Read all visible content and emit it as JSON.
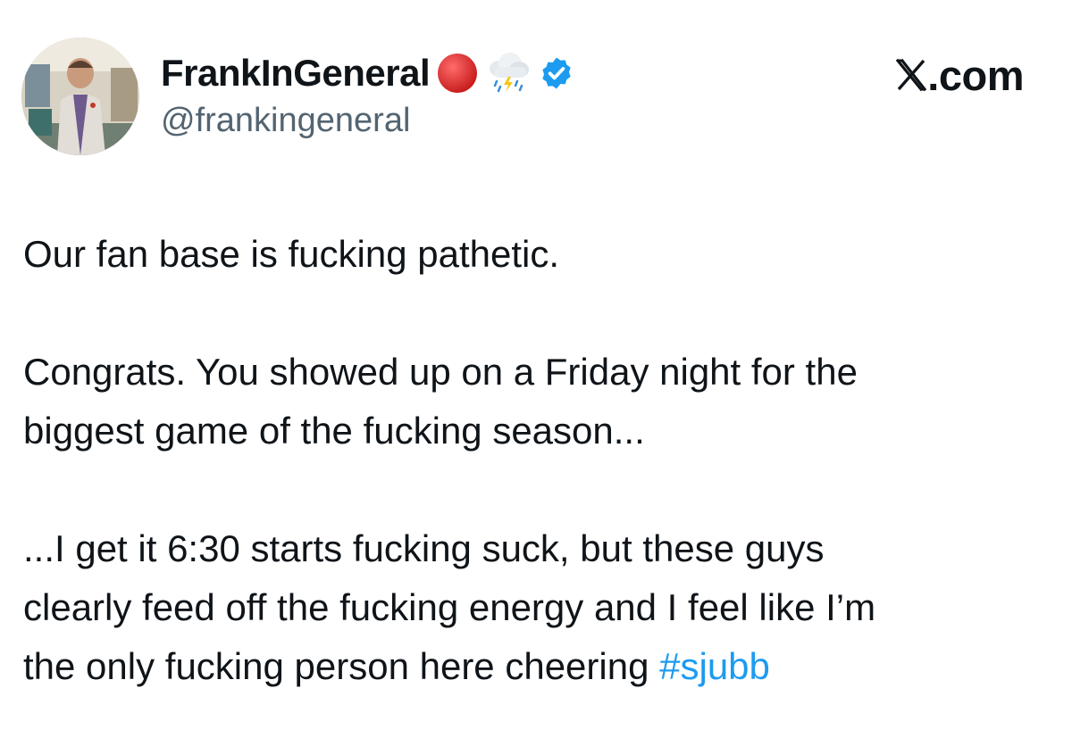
{
  "post": {
    "author": {
      "display_name": "FrankInGeneral",
      "handle": "@frankingeneral",
      "badges": [
        "red-circle-icon",
        "storm-cloud-icon",
        "verified-badge-icon"
      ]
    },
    "brand": {
      "logo": "x-logo-icon",
      "domain_suffix": ".com"
    },
    "body": {
      "paragraphs": [
        {
          "lines": [
            "Our fan base is fucking pathetic."
          ]
        },
        {
          "lines": [
            "Congrats. You showed up on a Friday night for the",
            "biggest game of the fucking season..."
          ]
        },
        {
          "lines": [
            "...I get it 6:30 starts fucking suck, but these guys",
            "clearly feed off the fucking energy and I feel like I’m",
            "the only fucking person here cheering "
          ],
          "hashtag": "#sjubb"
        }
      ]
    }
  },
  "colors": {
    "text": "#0f1419",
    "secondary_text": "#536471",
    "hashtag": "#1d9bf0",
    "verified": "#1d9bf0",
    "red_circle": "#d62828"
  }
}
